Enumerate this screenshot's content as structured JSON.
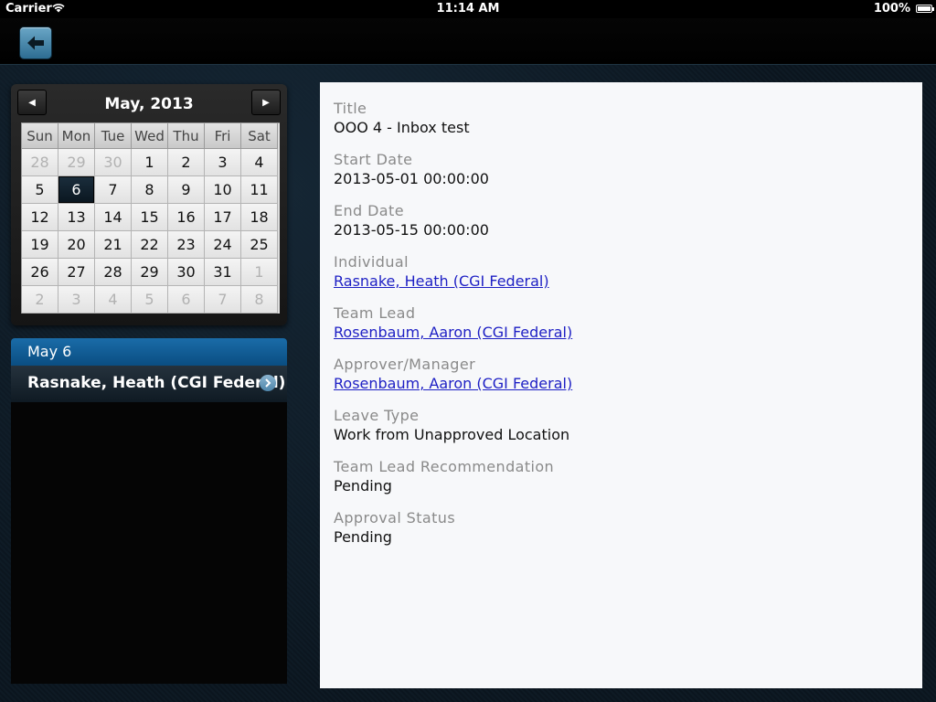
{
  "status_bar": {
    "carrier": "Carrier",
    "time": "11:14 AM",
    "battery": "100%"
  },
  "nav": {
    "back_icon": "arrow-left-icon"
  },
  "calendar": {
    "month_label": "May, 2013",
    "weekdays": [
      "Sun",
      "Mon",
      "Tue",
      "Wed",
      "Thu",
      "Fri",
      "Sat"
    ],
    "weeks": [
      [
        "28",
        "29",
        "30",
        "1",
        "2",
        "3",
        "4"
      ],
      [
        "5",
        "6",
        "7",
        "8",
        "9",
        "10",
        "11"
      ],
      [
        "12",
        "13",
        "14",
        "15",
        "16",
        "17",
        "18"
      ],
      [
        "19",
        "20",
        "21",
        "22",
        "23",
        "24",
        "25"
      ],
      [
        "26",
        "27",
        "28",
        "29",
        "30",
        "31",
        "1"
      ],
      [
        "2",
        "3",
        "4",
        "5",
        "6",
        "7",
        "8"
      ]
    ],
    "selected_day": "6"
  },
  "events": {
    "date_header": "May 6",
    "items": [
      {
        "label": "Rasnake, Heath (CGI Federal)"
      }
    ]
  },
  "detail": {
    "fields": [
      {
        "label": "Title",
        "value": "OOO 4 - Inbox test",
        "link": false
      },
      {
        "label": "Start Date",
        "value": "2013-05-01 00:00:00",
        "link": false
      },
      {
        "label": "End Date",
        "value": "2013-05-15 00:00:00",
        "link": false
      },
      {
        "label": "Individual",
        "value": "Rasnake, Heath (CGI Federal)",
        "link": true
      },
      {
        "label": "Team Lead",
        "value": "Rosenbaum, Aaron (CGI Federal)",
        "link": true
      },
      {
        "label": "Approver/Manager",
        "value": "Rosenbaum, Aaron (CGI Federal)",
        "link": true
      },
      {
        "label": "Leave Type",
        "value": "Work from Unapproved Location",
        "link": false
      },
      {
        "label": "Team Lead Recommendation",
        "value": "Pending",
        "link": false
      },
      {
        "label": "Approval Status",
        "value": "Pending",
        "link": false
      }
    ]
  }
}
